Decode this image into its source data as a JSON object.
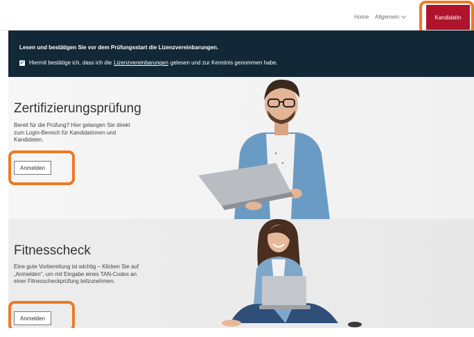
{
  "nav": {
    "home": "Home",
    "allgemein": "Allgemein",
    "kandidatin": "KandidatIn"
  },
  "banner": {
    "title": "Lesen und bestätigen Sie vor dem Prüfungsstart die Lizenzvereinbarungen.",
    "check_before": "Hiermit bestätige ich, dass ich die",
    "check_link": "Lizenzvereinbarungen",
    "check_after": "gelesen und zur Kenntnis genommen habe.",
    "checked": true
  },
  "sections": [
    {
      "title": "Zertifizierungsprüfung",
      "text": "Bereit für die Prüfung? Hier gelangen Sie direkt zum Login-Bereich für Kandidatinnen und Kandidaten.",
      "button": "Anmelden",
      "image": "man-with-laptop"
    },
    {
      "title": "Fitnesscheck",
      "text": "Eine gute Vorbereitung ist wichtig – Klicken Sie auf „Anmelden“, um mit Eingabe eines TAN-Codes an einer Fitnesscheckprüfung teilzunehmen.",
      "button": "Anmelden",
      "image": "woman-with-laptop"
    }
  ],
  "colors": {
    "accent_red": "#b0142c",
    "banner_bg": "#122836",
    "highlight_orange": "#ec7a25"
  }
}
